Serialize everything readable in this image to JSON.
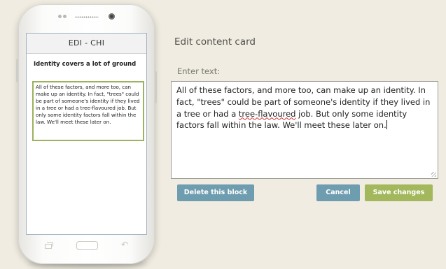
{
  "phone": {
    "screen_title": "EDI - CHI",
    "card_title": "Identity covers a lot of ground",
    "card_text": "All of these factors, and more too, can make up an identity. In fact, \"trees\" could be part of someone's identity if they lived in a tree or had a tree-flavoured job. But only some identity factors fall within the law. We'll meet these later on."
  },
  "editor": {
    "heading": "Edit content card",
    "label": "Enter text:",
    "text_before": "All of these factors, and more too, can make up an identity. In fact, \"trees\" could be part of someone's identity if they lived in a tree or had a ",
    "text_misspelled": "tree-flavoured",
    "text_after": " job. But only some identity factors fall within the law. We'll meet these later on."
  },
  "buttons": {
    "delete": "Delete this block",
    "cancel": "Cancel",
    "save": "Save changes"
  },
  "colors": {
    "background": "#f0ece1",
    "blue_button": "#6f9db0",
    "green_button": "#a3b85d",
    "card_border": "#9cb25f"
  }
}
